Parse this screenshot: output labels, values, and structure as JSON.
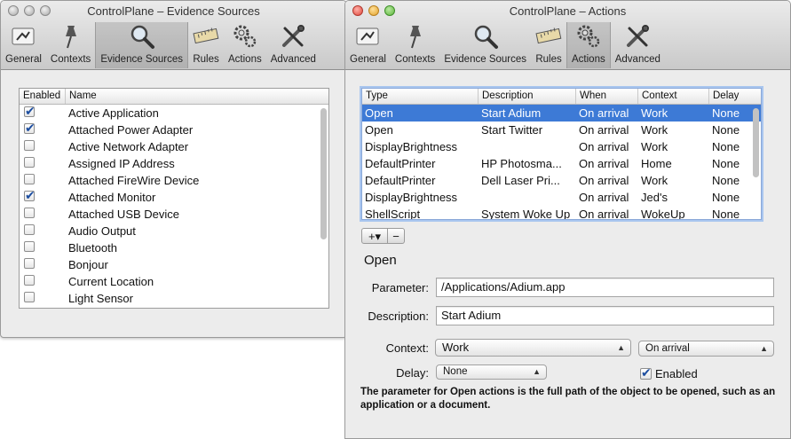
{
  "left_window": {
    "title": "ControlPlane – Evidence Sources",
    "toolbar": [
      {
        "label": "General",
        "icon": "switch-icon",
        "selected": false
      },
      {
        "label": "Contexts",
        "icon": "pushpin-icon",
        "selected": false
      },
      {
        "label": "Evidence Sources",
        "icon": "magnifier-icon",
        "selected": true
      },
      {
        "label": "Rules",
        "icon": "ruler-icon",
        "selected": false
      },
      {
        "label": "Actions",
        "icon": "gears-icon",
        "selected": false
      },
      {
        "label": "Advanced",
        "icon": "tools-icon",
        "selected": false
      }
    ],
    "columns": {
      "enabled": "Enabled",
      "name": "Name"
    },
    "sources": [
      {
        "name": "Active Application",
        "enabled": true
      },
      {
        "name": "Attached Power Adapter",
        "enabled": true
      },
      {
        "name": "Active Network Adapter",
        "enabled": false
      },
      {
        "name": "Assigned IP Address",
        "enabled": false
      },
      {
        "name": "Attached FireWire Device",
        "enabled": false
      },
      {
        "name": "Attached Monitor",
        "enabled": true
      },
      {
        "name": "Attached USB Device",
        "enabled": false
      },
      {
        "name": "Audio Output",
        "enabled": false
      },
      {
        "name": "Bluetooth",
        "enabled": false
      },
      {
        "name": "Bonjour",
        "enabled": false
      },
      {
        "name": "Current Location",
        "enabled": false
      },
      {
        "name": "Light Sensor",
        "enabled": false
      }
    ]
  },
  "right_window": {
    "title": "ControlPlane – Actions",
    "toolbar": [
      {
        "label": "General",
        "icon": "switch-icon",
        "selected": false
      },
      {
        "label": "Contexts",
        "icon": "pushpin-icon",
        "selected": false
      },
      {
        "label": "Evidence Sources",
        "icon": "magnifier-icon",
        "selected": false
      },
      {
        "label": "Rules",
        "icon": "ruler-icon",
        "selected": false
      },
      {
        "label": "Actions",
        "icon": "gears-icon",
        "selected": true
      },
      {
        "label": "Advanced",
        "icon": "tools-icon",
        "selected": false
      }
    ],
    "columns": {
      "type": "Type",
      "description": "Description",
      "when": "When",
      "context": "Context",
      "delay": "Delay"
    },
    "actions": [
      {
        "type": "Open",
        "description": "Start Adium",
        "when": "On arrival",
        "context": "Work",
        "delay": "None",
        "selected": true
      },
      {
        "type": "Open",
        "description": "Start Twitter",
        "when": "On arrival",
        "context": "Work",
        "delay": "None",
        "selected": false
      },
      {
        "type": "DisplayBrightness",
        "description": "",
        "when": "On arrival",
        "context": "Work",
        "delay": "None",
        "selected": false
      },
      {
        "type": "DefaultPrinter",
        "description": "HP Photosma...",
        "when": "On arrival",
        "context": "Home",
        "delay": "None",
        "selected": false
      },
      {
        "type": "DefaultPrinter",
        "description": "Dell Laser Pri...",
        "when": "On arrival",
        "context": "Work",
        "delay": "None",
        "selected": false
      },
      {
        "type": "DisplayBrightness",
        "description": "",
        "when": "On arrival",
        "context": "Jed's",
        "delay": "None",
        "selected": false
      },
      {
        "type": "ShellScript",
        "description": "System Woke Up",
        "when": "On arrival",
        "context": "WokeUp",
        "delay": "None",
        "selected": false
      }
    ],
    "add_button": "+▾",
    "remove_button": "−",
    "detail": {
      "section_title": "Open",
      "parameter_label": "Parameter:",
      "parameter_value": "/Applications/Adium.app",
      "description_label": "Description:",
      "description_value": "Start Adium",
      "context_label": "Context:",
      "context_value": "Work",
      "when_value": "On arrival",
      "delay_label": "Delay:",
      "delay_value": "None",
      "enabled_label": "Enabled",
      "enabled": true,
      "help_text": "The parameter for Open actions is the full path of the object to be opened, such as an application or a document."
    }
  },
  "colors": {
    "selection": "#3d7ad6",
    "checkmark": "#1d4ea0",
    "focus_ring": "#a9c6ef"
  }
}
